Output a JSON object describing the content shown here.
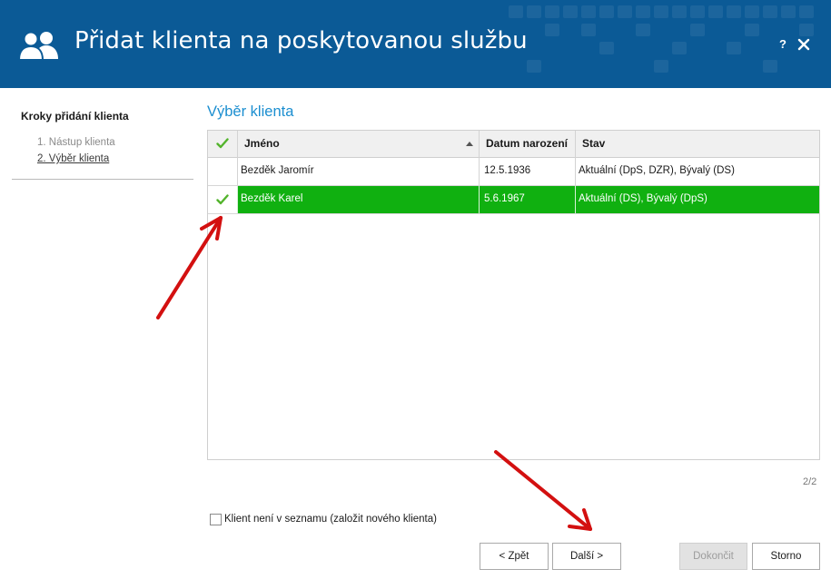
{
  "window": {
    "title": "Přidat klienta na poskytovanou službu",
    "help_label": "?",
    "icons": {
      "header": "users-icon",
      "close": "close-icon"
    },
    "colors": {
      "header_bg": "#0b5a96",
      "accent": "#1b8ed0",
      "selected_row": "#10b010",
      "check": "#53b42c"
    }
  },
  "sidebar": {
    "title": "Kroky přidání klienta",
    "steps": [
      {
        "label": "1. Nástup klienta"
      },
      {
        "label": "2. Výběr klienta"
      }
    ],
    "active_step": 2
  },
  "main": {
    "section_title": "Výběr klienta",
    "table": {
      "columns": [
        "Jméno",
        "Datum narození",
        "Stav"
      ],
      "sorted_column": "Jméno",
      "sort_direction": "ascending",
      "rows": [
        {
          "checked": false,
          "name": "Bezděk Jaromír",
          "birth_date": "12.5.1936",
          "status": "Aktuální (DpS, DZR), Bývalý (DS)"
        },
        {
          "checked": true,
          "name": "Bezděk Karel",
          "birth_date": "5.6.1967",
          "status": "Aktuální (DS), Bývalý (DpS)"
        }
      ],
      "selected_row": 2
    },
    "page_count": "2/2",
    "new_client_checkbox": {
      "label": "Klient není v seznamu (založit nového klienta)",
      "checked": false
    }
  },
  "buttons": {
    "back": "< Zpět",
    "next": "Další >",
    "finish": "Dokončit",
    "cancel": "Storno"
  }
}
